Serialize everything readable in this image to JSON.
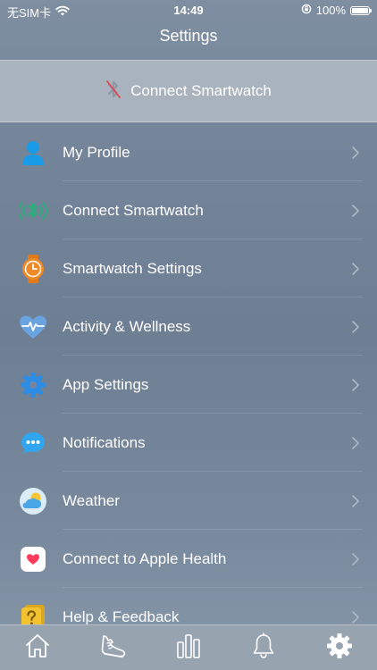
{
  "status_bar": {
    "carrier": "无SIM卡",
    "time": "14:49",
    "battery_percent": "100%",
    "battery_level": 1.0
  },
  "nav": {
    "title": "Settings"
  },
  "banner": {
    "label": "Connect Smartwatch",
    "icon": "bluetooth-disabled-icon"
  },
  "menu": {
    "items": [
      {
        "label": "My Profile",
        "icon": "profile-icon",
        "color": "#1a9be8"
      },
      {
        "label": "Connect Smartwatch",
        "icon": "bluetooth-icon",
        "color": "#27b07a"
      },
      {
        "label": "Smartwatch Settings",
        "icon": "watch-icon",
        "color": "#f08a26"
      },
      {
        "label": "Activity & Wellness",
        "icon": "heart-pulse-icon",
        "color": "#4f8fd8"
      },
      {
        "label": "App Settings",
        "icon": "gear-icon",
        "color": "#2d8ce6"
      },
      {
        "label": "Notifications",
        "icon": "chat-bubble-icon",
        "color": "#2fa6ef"
      },
      {
        "label": "Weather",
        "icon": "weather-icon",
        "color": "#5cb8ec"
      },
      {
        "label": "Connect to Apple Health",
        "icon": "apple-health-icon",
        "color": "#ff3b5c"
      },
      {
        "label": "Help & Feedback",
        "icon": "help-icon",
        "color": "#f2c230"
      }
    ]
  },
  "tabbar": {
    "tabs": [
      {
        "icon": "home-icon"
      },
      {
        "icon": "shoe-icon"
      },
      {
        "icon": "bar-chart-icon"
      },
      {
        "icon": "bell-icon"
      },
      {
        "icon": "gear-icon",
        "active": true
      }
    ]
  }
}
